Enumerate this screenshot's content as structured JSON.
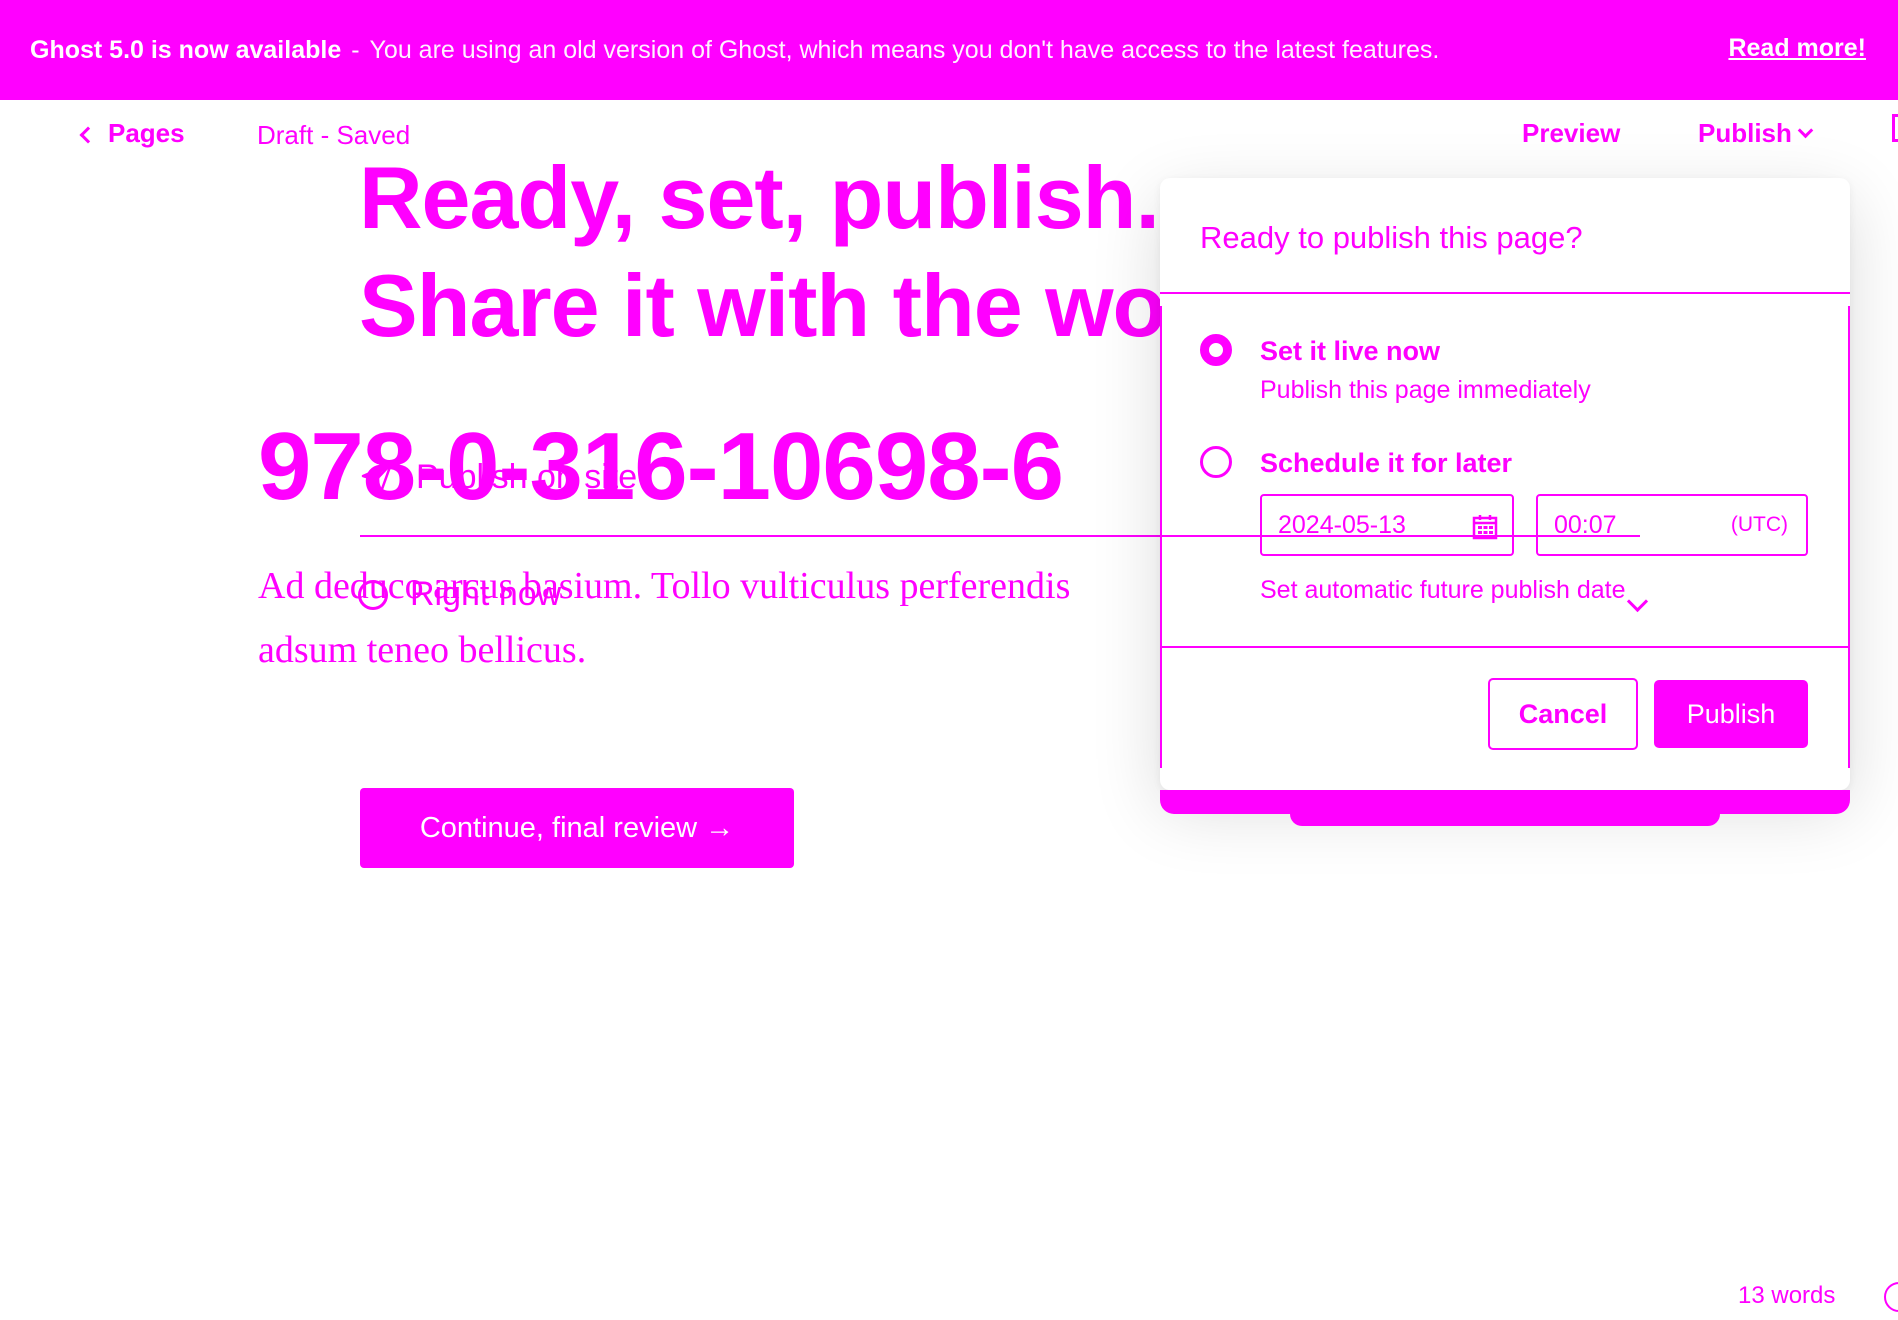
{
  "banner": {
    "title": "Ghost 5.0 is now available",
    "separator": "-",
    "message": "You are using an old version of Ghost, which means you don't have access to the latest features.",
    "link": "Read more!"
  },
  "header": {
    "back_label": "Pages",
    "status": "Draft - Saved",
    "preview_label": "Preview",
    "publish_label": "Publish"
  },
  "headline": {
    "line1": "Ready, set, publish.",
    "line2": "Share it with the world."
  },
  "content": {
    "title": "978-0-316-10698-6",
    "body": "Ad deduco arcus basium. Tollo vulticulus perferendis adsum teneo bellicus."
  },
  "publish_options": {
    "publish_on_site": "Publish on site",
    "right_now": "Right now",
    "continue_label": "Continue, final review →"
  },
  "dropdown": {
    "title": "Ready to publish this page?",
    "option_now": {
      "label": "Set it live now",
      "description": "Publish this page immediately",
      "selected": true
    },
    "option_later": {
      "label": "Schedule it for later",
      "selected": false
    },
    "date_value": "2024-05-13",
    "time_value": "00:07",
    "timezone": "(UTC)",
    "schedule_note": "Set automatic future publish date",
    "cancel_label": "Cancel",
    "publish_label": "Publish"
  },
  "footer": {
    "word_count": "13 words"
  },
  "colors": {
    "accent": "#ff00ff",
    "background": "#ffffff"
  },
  "icons": [
    "chevron-left-icon",
    "chevron-down-icon",
    "send-icon",
    "calendar-icon",
    "help-icon",
    "settings-toggle-icon"
  ]
}
